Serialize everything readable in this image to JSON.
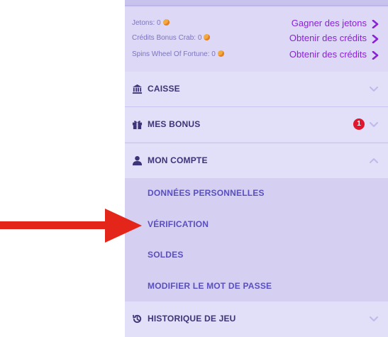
{
  "balances": [
    {
      "label": "Jetons: 0",
      "link": "Gagner des jetons"
    },
    {
      "label": "Crédits Bonus Crab: 0",
      "link": "Obtenir des crédits"
    },
    {
      "label": "Spins Wheel Of Fortune: 0",
      "link": "Obtenir des crédits"
    }
  ],
  "sections": {
    "caisse": {
      "title": "CAISSE",
      "icon": "bank-icon"
    },
    "bonus": {
      "title": "MES BONUS",
      "icon": "gift-icon",
      "badge": "1"
    },
    "compte": {
      "title": "MON COMPTE",
      "icon": "user-icon"
    },
    "historique": {
      "title": "HISTORIQUE DE JEU",
      "icon": "history-icon"
    }
  },
  "account_menu": [
    "DONNÉES PERSONNELLES",
    "VÉRIFICATION",
    "SOLDES",
    "MODIFIER LE MOT DE PASSE"
  ],
  "colors": {
    "panel": "#dcd8f6",
    "link": "#8a22d6",
    "section_title": "#3c3478",
    "submenu_text": "#5a4fc0",
    "badge": "#e0182f",
    "annotation_arrow": "#e32619"
  }
}
